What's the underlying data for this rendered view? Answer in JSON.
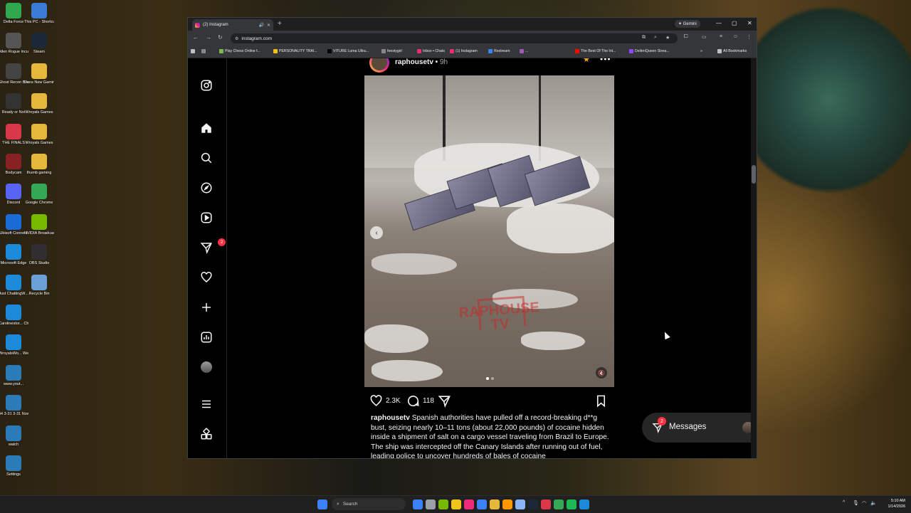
{
  "desktop": {
    "icons_left": [
      {
        "label": "Delta Force",
        "color": "#2fa84f"
      },
      {
        "label": "Allen Rogue Incursion",
        "color": "#555"
      },
      {
        "label": "Ghost Recon Breakpoint",
        "color": "#444"
      },
      {
        "label": "Ready or Not",
        "color": "#333"
      },
      {
        "label": "THE FINALS",
        "color": "#d9374a"
      },
      {
        "label": "Bodycam",
        "color": "#882222"
      },
      {
        "label": "Discord",
        "color": "#5865f2"
      },
      {
        "label": "Ubisoft Connect",
        "color": "#1a6ad8"
      },
      {
        "label": "Microsoft Edge",
        "color": "#1c8ad8"
      },
      {
        "label": "Just ChattingW...",
        "color": "#1c8ad8"
      },
      {
        "label": "Carolinestor... ChattingUv...",
        "color": "#1c8ad8"
      },
      {
        "label": "WroyalsWo... Wercyalse...",
        "color": "#1c8ad8"
      },
      {
        "label": "www.yout...",
        "color": "#2b7bb9"
      },
      {
        "label": "44 3-31 3-31 Now playin...",
        "color": "#2b7bb9"
      },
      {
        "label": "watch",
        "color": "#2b7bb9"
      },
      {
        "label": "Settings",
        "color": "#2b7bb9"
      }
    ],
    "icons_right": [
      {
        "label": "This PC - Shortcut",
        "color": "#3a7bd5"
      },
      {
        "label": "Steam",
        "color": "#1b2838"
      },
      {
        "label": "Dans New Gaming PICS",
        "color": "#e5b73b"
      },
      {
        "label": "Wroyals Games",
        "color": "#e5b73b"
      },
      {
        "label": "Wroyals Games",
        "color": "#e5b73b"
      },
      {
        "label": "thumb gaming",
        "color": "#e5b73b"
      },
      {
        "label": "Google Chrome",
        "color": "#34a853"
      },
      {
        "label": "NVIDIA Broadcast",
        "color": "#76b900"
      },
      {
        "label": "OBS Studio",
        "color": "#302e31"
      },
      {
        "label": "Recycle Bin",
        "color": "#6aa0d6"
      }
    ]
  },
  "browser": {
    "tab_title": "(2) Instagram",
    "tab_audio_icon": "speaker-icon",
    "gemini_label": "✦ Gemini",
    "url": "instagram.com",
    "bookmarks": [
      {
        "label": "Play Chess Online f...",
        "color": "#81b64c"
      },
      {
        "label": "PERSONALITY TRAI...",
        "color": "#f0c419"
      },
      {
        "label": "VITURE Luma Ultra...",
        "color": "#000000"
      },
      {
        "label": "feestygirl",
        "color": "#888888"
      },
      {
        "label": "Inbox • Chats",
        "color": "#ee2a7b"
      },
      {
        "label": "(1) Instagram",
        "color": "#ee2a7b"
      },
      {
        "label": "Restream",
        "color": "#3b82f6"
      },
      {
        "label": "...",
        "color": "#9b59b6"
      },
      {
        "label": "The Best Of The Int...",
        "color": "#ff0000"
      },
      {
        "label": "DeilenQueen Strea...",
        "color": "#9146ff"
      }
    ],
    "all_bookmarks": "All Bookmarks"
  },
  "instagram": {
    "notifications_badge": "2",
    "post": {
      "username": "raphousetv",
      "time": "9h",
      "likes": "2.3K",
      "comments": "118",
      "watermark_text": "RAPHOUSE TV",
      "caption_user": "raphousetv",
      "caption_text": "Spanish authorities have pulled off a record-breaking d**g bust, seizing nearly 10–11 tons (about 22,000 pounds) of cocaine hidden inside a shipment of salt on a cargo vessel traveling from Brazil to Europe. The ship was intercepted off the Canary Islands after running out of fuel, leading police to uncover hundreds of bales of cocaine"
    },
    "messages": {
      "label": "Messages",
      "badge": "2"
    }
  },
  "taskbar": {
    "search_placeholder": "Search",
    "time": "5:10 AM",
    "date": "1/14/2026",
    "apps": [
      "#3b82f6",
      "#9aa0a6",
      "#76b900",
      "#f0c419",
      "#ee2a7b",
      "#3b82f6",
      "#e5b73b",
      "#ff9800",
      "#8ab4f8",
      "#1b2838",
      "#d9374a",
      "#34a853",
      "#1db954",
      "#1c8ad8"
    ]
  }
}
